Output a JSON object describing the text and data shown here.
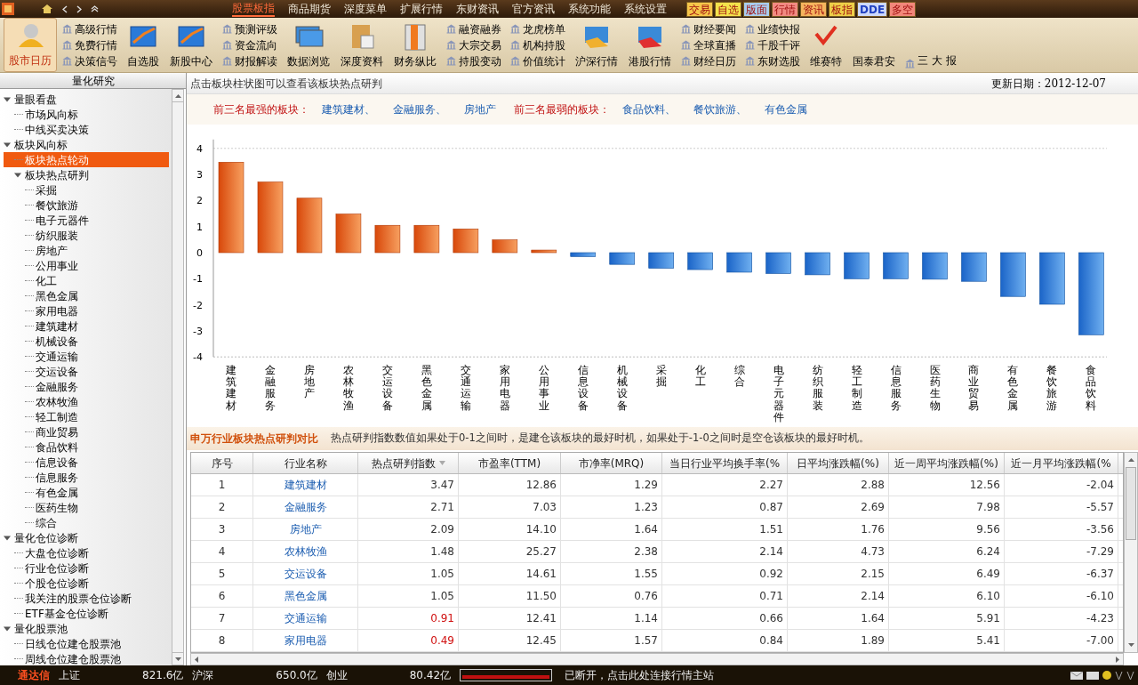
{
  "menubar": {
    "items": [
      {
        "label": "股票板指",
        "selected": true
      },
      {
        "label": "商品期货",
        "selected": false
      },
      {
        "label": "深度菜单",
        "selected": false
      },
      {
        "label": "扩展行情",
        "selected": false
      },
      {
        "label": "东财资讯",
        "selected": false
      },
      {
        "label": "官方资讯",
        "selected": false
      },
      {
        "label": "系统功能",
        "selected": false
      },
      {
        "label": "系统设置",
        "selected": false
      }
    ],
    "quick_tabs": [
      {
        "label": "交易",
        "color": "#f6c64a"
      },
      {
        "label": "自选",
        "color": "#f3e24c"
      },
      {
        "label": "版面",
        "color": "#a9cdee"
      },
      {
        "label": "行情",
        "color": "#f28a82"
      },
      {
        "label": "资讯",
        "color": "#f5b45e"
      },
      {
        "label": "板指",
        "color": "#eecf48"
      },
      {
        "label": "DDE",
        "color": "#cdd8fb"
      },
      {
        "label": "多空",
        "color": "#f2877a"
      }
    ]
  },
  "toolbar": [
    {
      "kind": "big",
      "label": "股市日历",
      "selected": true
    },
    {
      "kind": "links",
      "items": [
        "高级行情",
        "免费行情",
        "决策信号"
      ],
      "selected": false
    },
    {
      "kind": "big",
      "label": "自选股",
      "selected": false
    },
    {
      "kind": "big",
      "label": "新股中心",
      "selected": false
    },
    {
      "kind": "links",
      "items": [
        "预测评级",
        "资金流向",
        "财报解读"
      ],
      "selected": false
    },
    {
      "kind": "big",
      "label": "数据浏览",
      "selected": false
    },
    {
      "kind": "big",
      "label": "深度资料",
      "selected": false
    },
    {
      "kind": "big",
      "label": "财务纵比",
      "selected": false
    },
    {
      "kind": "links",
      "items": [
        "融资融券",
        "大宗交易",
        "持股变动"
      ],
      "selected": false
    },
    {
      "kind": "links",
      "items": [
        "龙虎榜单",
        "机构持股",
        "价值统计"
      ],
      "selected": false
    },
    {
      "kind": "big",
      "label": "沪深行情",
      "selected": false
    },
    {
      "kind": "big",
      "label": "港股行情",
      "selected": false
    },
    {
      "kind": "links",
      "items": [
        "财经要闻",
        "全球直播",
        "财经日历"
      ],
      "selected": false
    },
    {
      "kind": "links",
      "items": [
        "业绩快报",
        "千股千评",
        "东财选股"
      ],
      "selected": false
    },
    {
      "kind": "big",
      "label": "维赛特",
      "selected": false
    },
    {
      "kind": "big",
      "label": "国泰君安",
      "selected": false
    },
    {
      "kind": "link",
      "label": "三 大 报",
      "selected": false
    }
  ],
  "sidebar": {
    "title": "量化研究",
    "tree": [
      {
        "label": "量眼看盘",
        "expanded": true,
        "selected": false,
        "children": [
          {
            "label": "市场风向标",
            "selected": false
          },
          {
            "label": "中线买卖决策",
            "selected": false
          }
        ]
      },
      {
        "label": "板块风向标",
        "expanded": true,
        "selected": false,
        "children": [
          {
            "label": "板块热点轮动",
            "selected": true
          },
          {
            "label": "板块热点研判",
            "expanded": true,
            "selected": false,
            "children": [
              {
                "label": "采掘",
                "selected": false
              },
              {
                "label": "餐饮旅游",
                "selected": false
              },
              {
                "label": "电子元器件",
                "selected": false
              },
              {
                "label": "纺织服装",
                "selected": false
              },
              {
                "label": "房地产",
                "selected": false
              },
              {
                "label": "公用事业",
                "selected": false
              },
              {
                "label": "化工",
                "selected": false
              },
              {
                "label": "黑色金属",
                "selected": false
              },
              {
                "label": "家用电器",
                "selected": false
              },
              {
                "label": "建筑建材",
                "selected": false
              },
              {
                "label": "机械设备",
                "selected": false
              },
              {
                "label": "交通运输",
                "selected": false
              },
              {
                "label": "交运设备",
                "selected": false
              },
              {
                "label": "金融服务",
                "selected": false
              },
              {
                "label": "农林牧渔",
                "selected": false
              },
              {
                "label": "轻工制造",
                "selected": false
              },
              {
                "label": "商业贸易",
                "selected": false
              },
              {
                "label": "食品饮料",
                "selected": false
              },
              {
                "label": "信息设备",
                "selected": false
              },
              {
                "label": "信息服务",
                "selected": false
              },
              {
                "label": "有色金属",
                "selected": false
              },
              {
                "label": "医药生物",
                "selected": false
              },
              {
                "label": "综合",
                "selected": false
              }
            ]
          }
        ]
      },
      {
        "label": "量化仓位诊断",
        "expanded": true,
        "selected": false,
        "children": [
          {
            "label": "大盘仓位诊断",
            "selected": false
          },
          {
            "label": "行业仓位诊断",
            "selected": false
          },
          {
            "label": "个股仓位诊断",
            "selected": false
          },
          {
            "label": "我关注的股票仓位诊断",
            "selected": false
          },
          {
            "label": "ETF基金仓位诊断",
            "selected": false
          }
        ]
      },
      {
        "label": "量化股票池",
        "expanded": true,
        "selected": false,
        "children": [
          {
            "label": "日线仓位建仓股票池",
            "selected": false
          },
          {
            "label": "周线仓位建仓股票池",
            "selected": false
          }
        ]
      }
    ]
  },
  "header": {
    "hint": "点击板块柱状图可以查看该板块热点研判",
    "update_label": "更新日期：",
    "update_date": "2012-12-07"
  },
  "summary": {
    "strong_label": "前三名最强的板块：",
    "strong": [
      "建筑建材、",
      "金融服务、",
      "房地产"
    ],
    "weak_label": "前三名最弱的板块：",
    "weak": [
      "食品饮料、",
      "餐饮旅游、",
      "有色金属"
    ]
  },
  "chart_data": {
    "type": "bar",
    "categories": [
      "建筑建材",
      "金融服务",
      "房地产",
      "农林牧渔",
      "交运设备",
      "黑色金属",
      "交通运输",
      "家用电器",
      "公用事业",
      "信息设备",
      "机械设备",
      "采掘",
      "化工",
      "综合",
      "电子元器件",
      "纺织服装",
      "轻工制造",
      "信息服务",
      "医药生物",
      "商业贸易",
      "有色金属",
      "餐饮旅游",
      "食品饮料"
    ],
    "values": [
      3.47,
      2.71,
      2.09,
      1.48,
      1.05,
      1.05,
      0.91,
      0.49,
      0.1,
      -0.15,
      -0.45,
      -0.6,
      -0.65,
      -0.75,
      -0.8,
      -0.85,
      -1.0,
      -1.0,
      -1.02,
      -1.1,
      -1.68,
      -1.98,
      -3.15
    ],
    "ylim": [
      -4,
      4
    ],
    "yticks": [
      -4,
      -3,
      -2,
      -1,
      0,
      1,
      2,
      3,
      4
    ]
  },
  "comparison": {
    "title": "申万行业板块热点研判对比",
    "note": "热点研判指数数值如果处于0-1之间时，是建仓该板块的最好时机，如果处于-1-0之间时是空仓该板块的最好时机。"
  },
  "table": {
    "columns": [
      {
        "label": "序号",
        "sorted": false
      },
      {
        "label": "行业名称",
        "sorted": false
      },
      {
        "label": "热点研判指数",
        "sorted": true
      },
      {
        "label": "市盈率(TTM)",
        "sorted": false
      },
      {
        "label": "市净率(MRQ)",
        "sorted": false
      },
      {
        "label": "当日行业平均换手率(%",
        "sorted": false
      },
      {
        "label": "日平均涨跌幅(%)",
        "sorted": false
      },
      {
        "label": "近一周平均涨跌幅(%)",
        "sorted": false
      },
      {
        "label": "近一月平均涨跌幅(%",
        "sorted": false
      }
    ],
    "rows": [
      {
        "cells": [
          "1",
          "建筑建材",
          "3.47",
          "12.86",
          "1.29",
          "2.27",
          "2.88",
          "12.56",
          "-2.04"
        ],
        "index_highlight": false
      },
      {
        "cells": [
          "2",
          "金融服务",
          "2.71",
          "7.03",
          "1.23",
          "0.87",
          "2.69",
          "7.98",
          "-5.57"
        ],
        "index_highlight": false
      },
      {
        "cells": [
          "3",
          "房地产",
          "2.09",
          "14.10",
          "1.64",
          "1.51",
          "1.76",
          "9.56",
          "-3.56"
        ],
        "index_highlight": false
      },
      {
        "cells": [
          "4",
          "农林牧渔",
          "1.48",
          "25.27",
          "2.38",
          "2.14",
          "4.73",
          "6.24",
          "-7.29"
        ],
        "index_highlight": false
      },
      {
        "cells": [
          "5",
          "交运设备",
          "1.05",
          "14.61",
          "1.55",
          "0.92",
          "2.15",
          "6.49",
          "-6.37"
        ],
        "index_highlight": false
      },
      {
        "cells": [
          "6",
          "黑色金属",
          "1.05",
          "11.50",
          "0.76",
          "0.71",
          "2.14",
          "6.10",
          "-6.10"
        ],
        "index_highlight": false
      },
      {
        "cells": [
          "7",
          "交通运输",
          "0.91",
          "12.41",
          "1.14",
          "0.66",
          "1.64",
          "5.91",
          "-4.23"
        ],
        "index_highlight": true
      },
      {
        "cells": [
          "8",
          "家用电器",
          "0.49",
          "12.45",
          "1.57",
          "0.84",
          "1.89",
          "5.41",
          "-7.00"
        ],
        "index_highlight": true
      }
    ]
  },
  "status_bar": {
    "brand": "通达信",
    "markets": [
      {
        "name": "上证",
        "amount": "821.6亿"
      },
      {
        "name": "沪深",
        "amount": "650.0亿"
      },
      {
        "name": "创业",
        "amount": "80.42亿"
      }
    ],
    "connection": "已断开，点击此处连接行情主站"
  }
}
